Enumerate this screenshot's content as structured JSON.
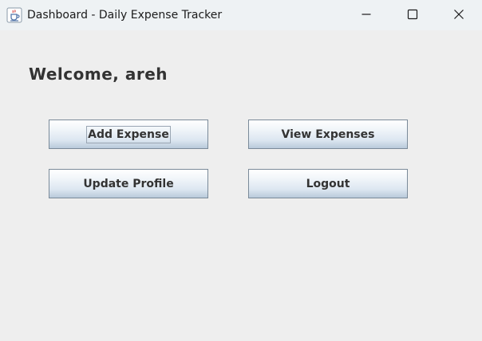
{
  "window": {
    "title": "Dashboard - Daily Expense Tracker",
    "app_icon": "java-cup-icon",
    "controls": {
      "minimize": "minimize-icon",
      "maximize": "maximize-icon",
      "close": "close-icon"
    }
  },
  "main": {
    "welcome_text": "Welcome, areh",
    "buttons": {
      "add_expense": "Add Expense",
      "view_expenses": "View Expenses",
      "update_profile": "Update Profile",
      "logout": "Logout"
    },
    "focused_button": "Add Expense"
  },
  "colors": {
    "background": "#eeeeee",
    "titlebar": "#eef2f4",
    "button_border": "#7a8a99",
    "text": "#333333"
  }
}
